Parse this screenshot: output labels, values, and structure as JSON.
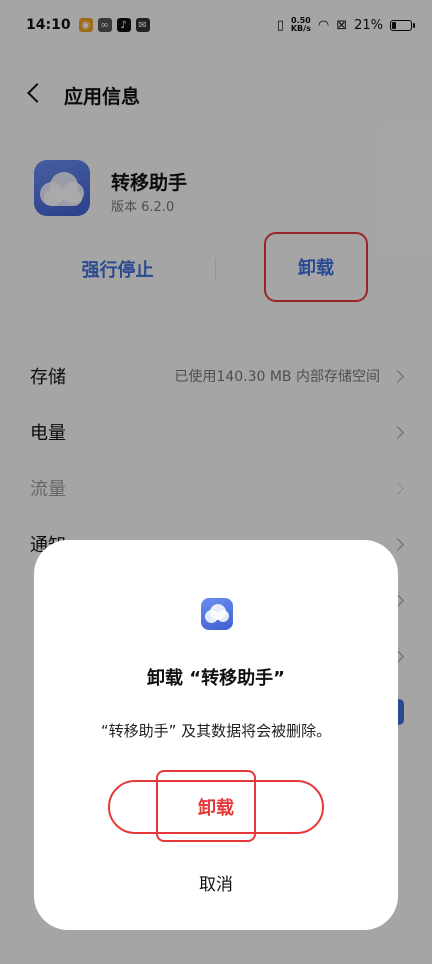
{
  "status_bar": {
    "time": "14:10",
    "net_speed_value": "0.50",
    "net_speed_unit": "KB/s",
    "battery": "21%",
    "battery_level": 0.21
  },
  "header": {
    "title": "应用信息"
  },
  "app": {
    "name": "转移助手",
    "version": "版本 6.2.0"
  },
  "actions": {
    "force_stop": "强行停止",
    "uninstall": "卸载"
  },
  "settings": [
    {
      "label": "存储",
      "value": "已使用140.30 MB 内部存储空间",
      "disabled": false
    },
    {
      "label": "电量",
      "value": "",
      "disabled": false
    },
    {
      "label": "流量",
      "value": "",
      "disabled": true
    },
    {
      "label": "通知",
      "value": "",
      "disabled": false
    }
  ],
  "dialog": {
    "title": "卸载 “转移助手”",
    "message": "“转移助手” 及其数据将会被删除。",
    "confirm": "卸载",
    "cancel": "取消"
  },
  "colors": {
    "accent_blue": "#3f6fd8",
    "highlight_red": "#e5393b"
  }
}
